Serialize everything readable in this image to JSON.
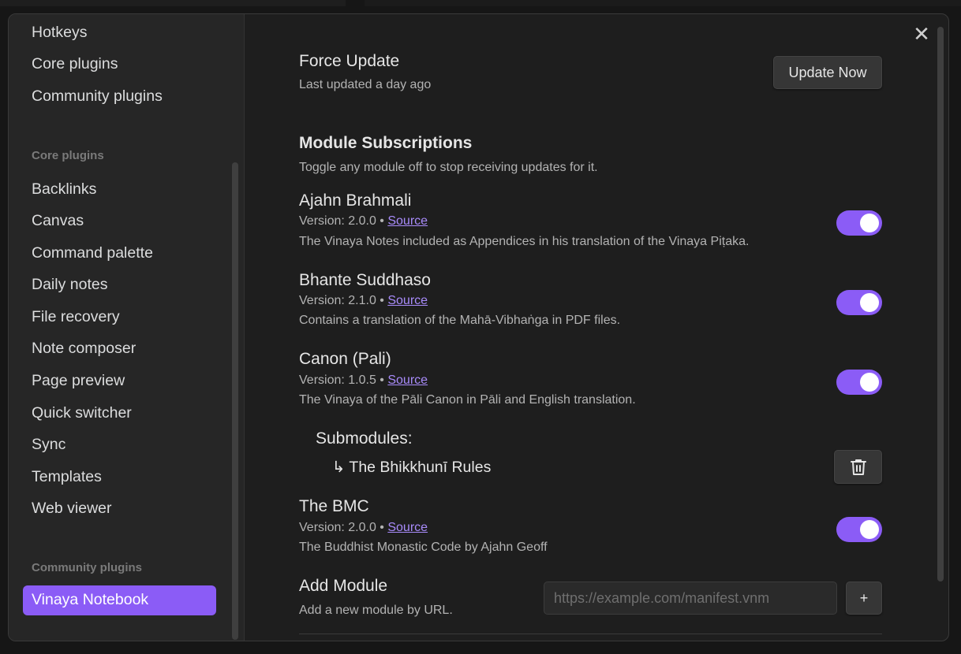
{
  "sidebar": {
    "top_items": [
      "Hotkeys",
      "Core plugins",
      "Community plugins"
    ],
    "core_heading": "Core plugins",
    "core_items": [
      "Backlinks",
      "Canvas",
      "Command palette",
      "Daily notes",
      "File recovery",
      "Note composer",
      "Page preview",
      "Quick switcher",
      "Sync",
      "Templates",
      "Web viewer"
    ],
    "community_heading": "Community plugins",
    "active_item": "Vinaya Notebook"
  },
  "force_update": {
    "title": "Force Update",
    "desc": "Last updated a day ago",
    "button": "Update Now"
  },
  "subscriptions": {
    "title": "Module Subscriptions",
    "desc": "Toggle any module off to stop receiving updates for it."
  },
  "modules": [
    {
      "name": "Ajahn Brahmali",
      "version": "Version: 2.0.0 • ",
      "link": "Source",
      "desc": "The Vinaya Notes included as Appendices in his translation of the Vinaya Piṭaka.",
      "enabled": true
    },
    {
      "name": "Bhante Suddhaso",
      "version": "Version: 2.1.0 • ",
      "link": "Source",
      "desc": "Contains a translation of the Mahā-Vibhaṅga in PDF files.",
      "enabled": true
    },
    {
      "name": "Canon (Pali)",
      "version": "Version: 1.0.5 • ",
      "link": "Source",
      "desc": "The Vinaya of the Pāli Canon in Pāli and English translation.",
      "enabled": true
    },
    {
      "name": "The BMC",
      "version": "Version: 2.0.0 • ",
      "link": "Source",
      "desc": "The Buddhist Monastic Code by Ajahn Geoff",
      "enabled": true
    }
  ],
  "submodules": {
    "label": "Submodules:",
    "item": "↳ The Bhikkhunī Rules"
  },
  "add_module": {
    "title": "Add Module",
    "desc": "Add a new module by URL.",
    "placeholder": "https://example.com/manifest.vnm",
    "button": "+"
  },
  "icons": {
    "close": "close-icon",
    "trash": "trash-icon"
  },
  "colors": {
    "accent": "#8b5cf6",
    "link": "#a88bfa"
  }
}
